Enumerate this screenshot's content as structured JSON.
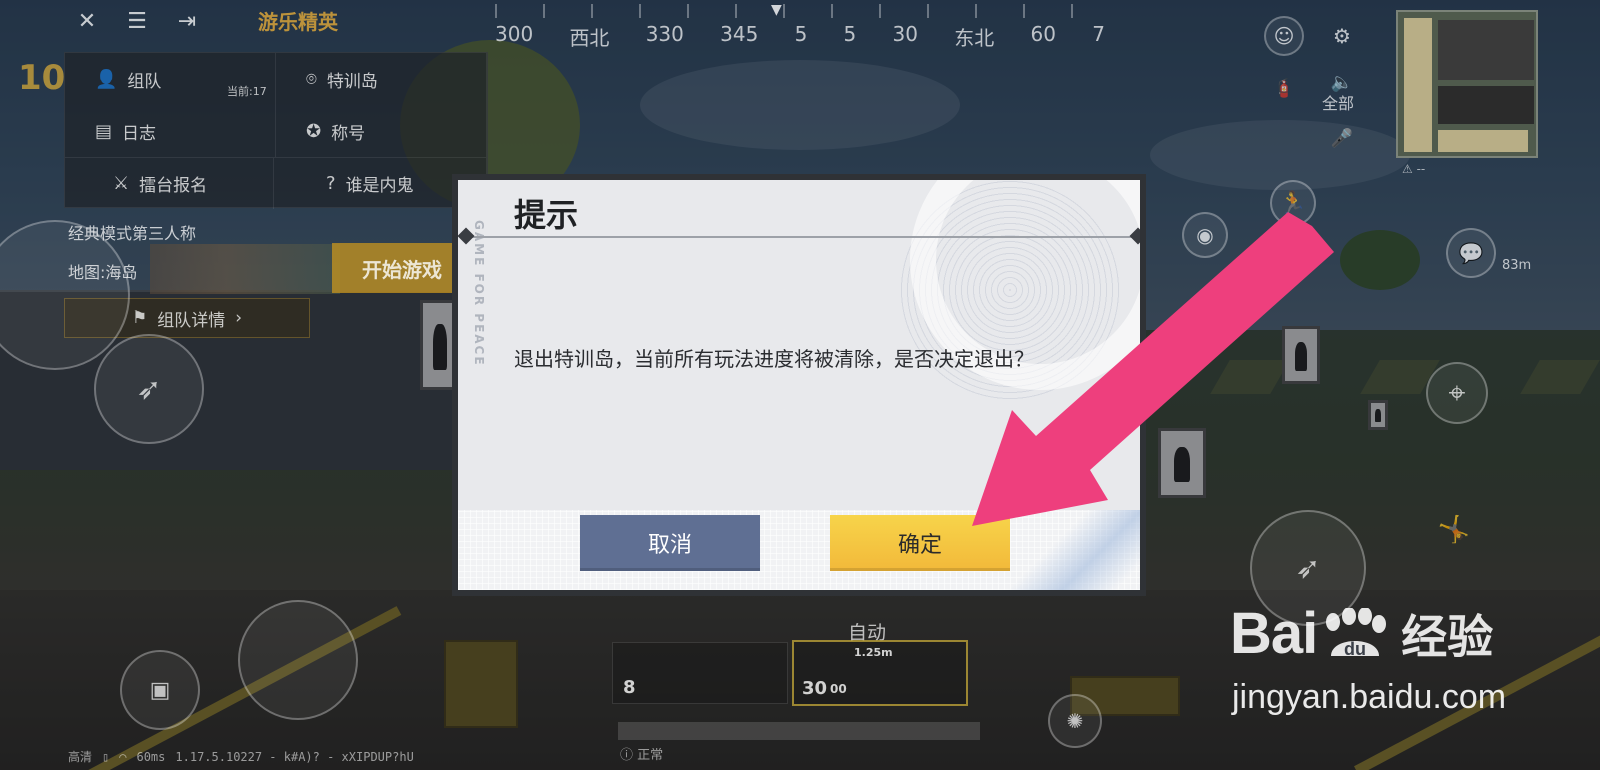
{
  "hud": {
    "game_title": "游乐精英",
    "score": "10",
    "compass": [
      "300",
      "西北",
      "330",
      "345",
      "5",
      "5",
      "30",
      "东北",
      "60",
      "7"
    ],
    "icons": [
      "close-icon",
      "settings-sliders-icon",
      "exit-icon"
    ]
  },
  "menu": {
    "team": "组队",
    "training_island": "特训岛",
    "training_sub": "当前:17",
    "log": "日志",
    "title": "称号",
    "arena_signup": "擂台报名",
    "who_is_spy": "谁是内鬼"
  },
  "mode": {
    "mode_label": "经典模式第三人称",
    "map_label": "地图:海岛",
    "start_button": "开始游戏",
    "team_detail": "组队详情"
  },
  "right_hud": {
    "voice_all": "全部",
    "minimap_dist": "--",
    "distance": "83m"
  },
  "weapons": {
    "fire_mode": "自动",
    "slot1_ammo": "8",
    "slot2_ammo": "30",
    "slot2_reserve": "00",
    "scope": "1.25m"
  },
  "status": {
    "quality": "高清",
    "ping": "60ms",
    "version": "1.17.5.10227 - k#A)? - xXIPDUP?hU",
    "stance": "正常"
  },
  "dialog": {
    "title": "提示",
    "watermark": "GAME FOR PEACE",
    "message": "退出特训岛，当前所有玩法进度将被清除，是否决定退出？",
    "cancel": "取消",
    "confirm": "确定"
  },
  "watermark": {
    "brand": "Bai",
    "brand_du": "du",
    "brand_cn": "经验",
    "url": "jingyan.baidu.com"
  },
  "colors": {
    "cancel_button": "#5f6f93",
    "confirm_button": "#f2c43f",
    "arrow": "#ee3f7d"
  }
}
